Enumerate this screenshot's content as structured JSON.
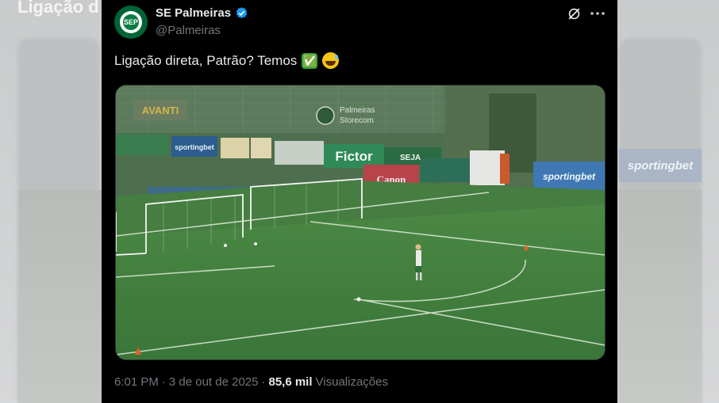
{
  "background": {
    "title": "Ligação d",
    "sign_right": "sportingbet"
  },
  "tweet": {
    "display_name": "SE Palmeiras",
    "handle": "@Palmeiras",
    "avatar_text": "SEP",
    "text": "Ligação direta, Patrão? Temos",
    "emojis": [
      "✅",
      "😅"
    ],
    "time": "6:01 PM",
    "separator": "·",
    "date": "3 de out de 2025",
    "views_count": "85,6 mil",
    "views_label": "Visualizações"
  },
  "media": {
    "ads": {
      "avanti": "AVANTI",
      "palmeiras_store_1": "Palmeiras",
      "palmeiras_store_2": "Storecom",
      "sportingbet_a": "sportingbet",
      "fictor": "Fictor",
      "seja": "SEJA",
      "canon": "Canon",
      "sportingbet_b": "sportingbet"
    }
  },
  "colors": {
    "card_bg": "#000000",
    "text_primary": "#e7e9ea",
    "text_secondary": "#71767b",
    "verified": "#1d9bf0",
    "palmeiras_green": "#006437",
    "pitch": "#3f7a3c"
  },
  "icons": {
    "verified": "verified-badge-icon",
    "grok": "grok-icon",
    "more": "more-icon"
  }
}
